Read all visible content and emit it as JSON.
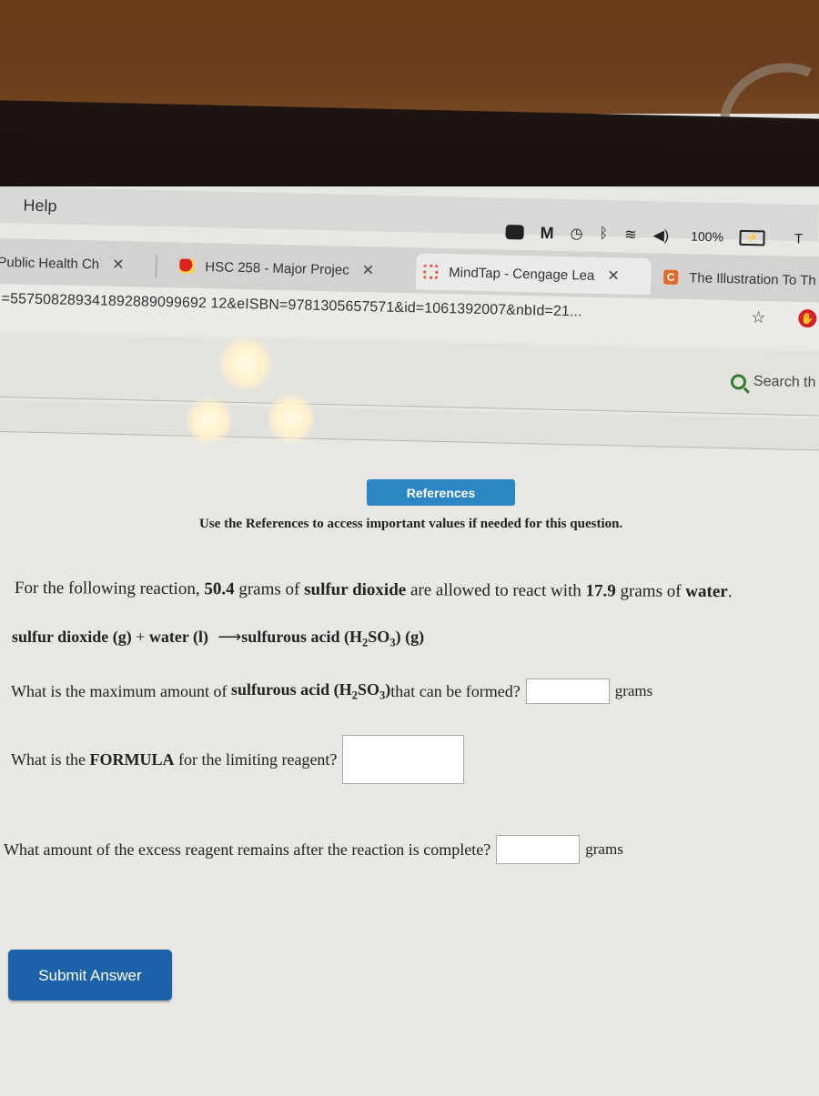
{
  "os": {
    "menu": {
      "help_label": "Help"
    },
    "status": {
      "icons": [
        "zoom-icon",
        "malwarebytes-icon",
        "time-machine-icon",
        "bluetooth-icon",
        "wifi-icon",
        "volume-icon"
      ],
      "battery_percent": "100%",
      "clock_partial": "T"
    }
  },
  "browser": {
    "tabs": [
      {
        "title": "Public Health Ch",
        "favicon": "none",
        "active": false
      },
      {
        "title": "HSC 258 - Major Projec",
        "favicon": "cardinal-logo",
        "active": false
      },
      {
        "title": "MindTap - Cengage Lea",
        "favicon": "mindtap-logo",
        "active": true
      },
      {
        "title": "The Illustration To Th",
        "favicon": "c-logo",
        "active": false
      }
    ],
    "tab_close_glyph": "✕",
    "url": "=557508289341892889099692 12&eISBN=9781305657571&id=1061392007&nbId=21...",
    "bookmark_icon": "☆",
    "extension_icon": "stop-hand-icon"
  },
  "site": {
    "search_label": "Search th"
  },
  "question": {
    "references_button": "References",
    "references_note": "Use the References to access important values if needed for this question.",
    "intro": {
      "part1": "For the following reaction, ",
      "so2_mass": "50.4",
      "part2": " grams of ",
      "reactant1": "sulfur dioxide",
      "part3": " are allowed to react with ",
      "water_mass": "17.9",
      "part4": " grams of ",
      "reactant2": "water",
      "part5": "."
    },
    "equation": {
      "reactant1": "sulfur dioxide (g)",
      "plus": " + ",
      "reactant2": "water (l)",
      "arrow": "⟶",
      "product": "sulfurous acid (H",
      "sub2": "2",
      "so": "SO",
      "sub3": "3",
      "tail": ") (g)"
    },
    "q1": {
      "pre": "What is the maximum amount of ",
      "bold": "sulfurous acid (H",
      "sub2": "2",
      "so": "SO",
      "sub3": "3",
      "close": ")",
      "post": " that can be formed?",
      "value": "",
      "unit": "grams"
    },
    "q2": {
      "pre": "What is the ",
      "bold": "FORMULA",
      "post": " for the limiting reagent?",
      "value": ""
    },
    "q3": {
      "text": "What amount of the excess reagent remains after the reaction is complete?",
      "value": "",
      "unit": "grams"
    },
    "submit_button": "Submit Answer"
  }
}
